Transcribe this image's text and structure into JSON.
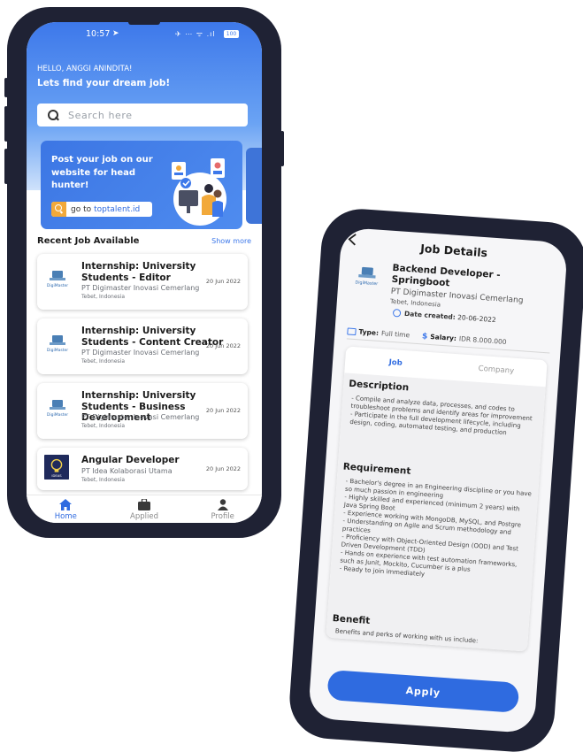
{
  "home": {
    "status": {
      "time": "10:57",
      "icons": "✈ ⋯ ᯤ .ıl",
      "battery": "100"
    },
    "greeting": "HELLO, ANGGI ANINDITA!",
    "tagline": "Lets find your dream job!",
    "search_placeholder": "Search here",
    "banner": {
      "title": "Post your job on our website for head hunter!",
      "link_prefix": "go to",
      "link_url": "toptalent.id"
    },
    "recent_title": "Recent Job Available",
    "show_more": "Show more",
    "jobs": [
      {
        "title": "Internship: University Students - Editor",
        "company": "PT Digimaster Inovasi Cemerlang",
        "location": "Tebet, Indonesia",
        "date": "20 Jun 2022",
        "logo": "digimaster-logo"
      },
      {
        "title": "Internship: University Students - Content Creator",
        "company": "PT Digimaster Inovasi Cemerlang",
        "location": "Tebet, Indonesia",
        "date": "20 Jun 2022",
        "logo": "digimaster-logo"
      },
      {
        "title": "Internship: University Students - Business Development",
        "company": "PT Digimaster Inovasi Cemerlang",
        "location": "Tebet, Indonesia",
        "date": "20 Jun 2022",
        "logo": "digimaster-logo"
      },
      {
        "title": "Angular Developer",
        "company": "PT Idea Kolaborasi Utama",
        "location": "Tebet, Indonesia",
        "date": "20 Jun 2022",
        "logo": "ideas-logo"
      }
    ],
    "nav": [
      {
        "label": "Home",
        "icon": "home-icon",
        "active": true
      },
      {
        "label": "Applied",
        "icon": "briefcase-icon",
        "active": false
      },
      {
        "label": "Profile",
        "icon": "profile-icon",
        "active": false
      }
    ]
  },
  "details": {
    "header": "Job Details",
    "job_title": "Backend Developer - Springboot",
    "company": "PT Digimaster Inovasi Cemerlang",
    "location": "Tebet, Indonesia",
    "date_label": "Date created:",
    "date_value": "20-06-2022",
    "type_label": "Type:",
    "type_value": "Full time",
    "salary_label": "Salary:",
    "salary_value": "IDR 8.000.000",
    "tabs": [
      "Job",
      "Company"
    ],
    "description_title": "Description",
    "description_body": "- Compile and analyze data, processes, and codes to troubleshoot problems and identify areas for improvement\n- Participate in the full development lifecycle, including design, coding, automated testing, and production",
    "requirement_title": "Requirement",
    "requirement_body": "- Bachelor's degree in an Engineering discipline or you have so much passion in engineering\n- Highly skilled and experienced (minimum 2 years) with Java Spring Boot\n- Experience working with MongoDB, MySQL, and Postgre\n- Understanding on Agile and Scrum methodology and practices\n- Proficiency with Object-Oriented Design (OOD) and Test Driven Development (TDD)\n- Hands on experience with test automation frameworks, such as Junit, Mockito, Cucumber is a plus\n- Ready to join immediately",
    "benefit_title": "Benefit",
    "benefit_body": "Benefits and perks of working with us include:",
    "apply_label": "Apply"
  },
  "colors": {
    "primary": "#2f6be0",
    "accent": "#f2a93a",
    "frame": "#1f2234"
  }
}
